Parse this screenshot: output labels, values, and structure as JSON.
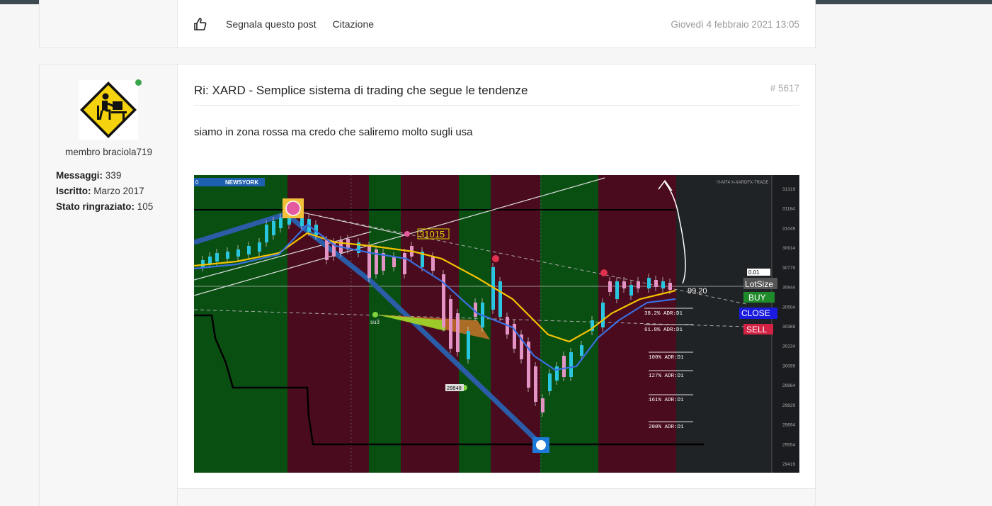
{
  "previous_post": {
    "actions": {
      "report_label": "Segnala questo post",
      "quote_label": "Citazione"
    },
    "date": "Giovedì 4 febbraio 2021 13:05"
  },
  "author": {
    "username": "membro braciola719",
    "stats": [
      {
        "label": "Messaggi:",
        "value": "339"
      },
      {
        "label": "Iscritto:",
        "value": "Marzo 2017"
      },
      {
        "label": "Stato ringraziato:",
        "value": "105"
      }
    ],
    "online_color": "#3aa54b"
  },
  "post": {
    "title": "Ri: XARD - Semplice sistema di trading che segue le tendenze",
    "number": "# 5617",
    "body": "siamo in zona rossa ma credo che saliremo molto sugli usa"
  },
  "chart_image": {
    "header_left": "NEWSYORK",
    "header_right": "!!!-MT4 X-XARDFX-TRADE",
    "zero_label": "0",
    "price_scale": [
      "31319",
      "31184",
      "31049",
      "30914",
      "30779",
      "30644",
      "30504",
      "30369",
      "30234",
      "30099",
      "29964",
      "29829",
      "29694",
      "29554",
      "29419"
    ],
    "level_label": "31015",
    "low_label": "29948",
    "su_label": "su3",
    "current_price": "99.20",
    "adr_labels": [
      "38.2% ADR:D1",
      "61.8% ADR:D1",
      "100% ADR:D1",
      "127% ADR:D1",
      "161% ADR:D1",
      "200% ADR:D1"
    ],
    "panel": {
      "lot_value": "0.01",
      "lot_label": "LotSize",
      "buy_label": "BUY",
      "close_label": "CLOSE",
      "sell_label": "SELL"
    },
    "colors": {
      "green_zone": "#0a4f12",
      "red_zone": "#4a0b1e",
      "buy": "#1f8a2a",
      "close": "#1b1be0",
      "sell": "#d42244"
    }
  }
}
